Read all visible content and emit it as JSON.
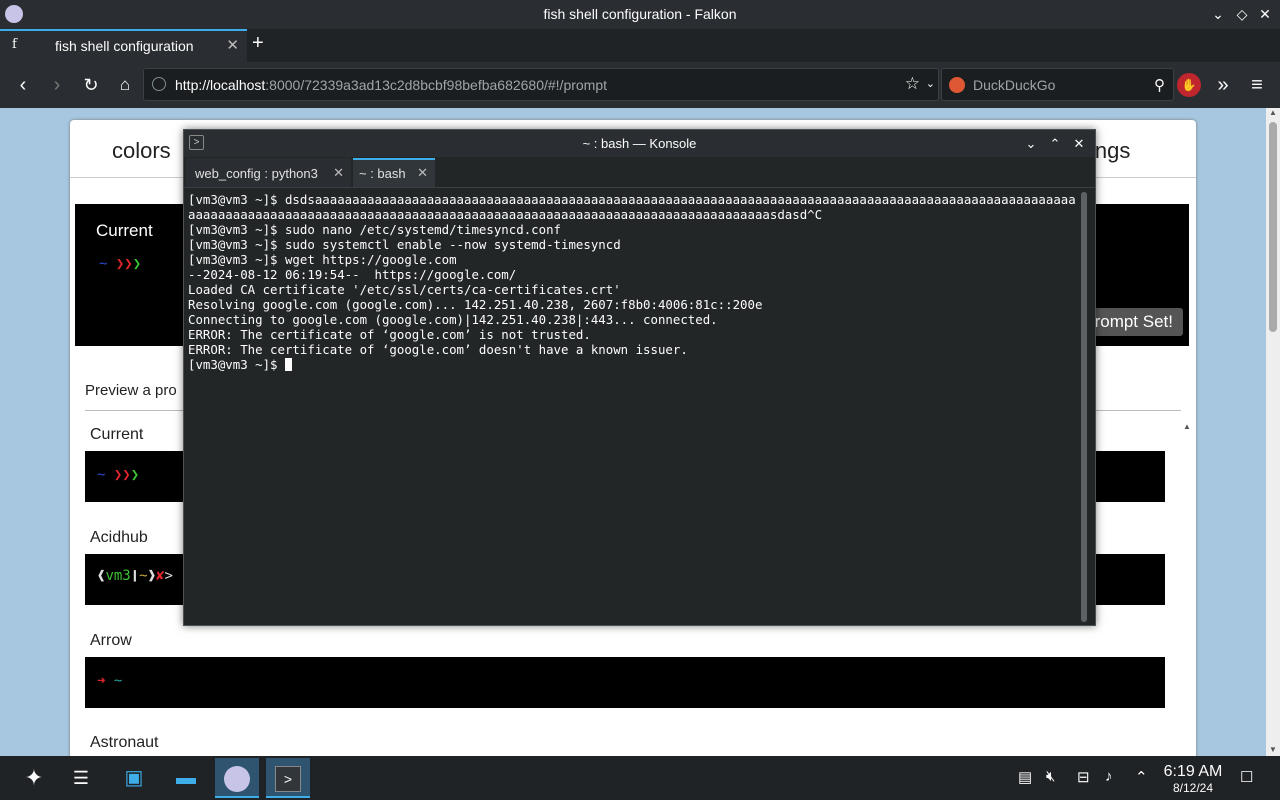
{
  "window": {
    "title": "fish shell configuration - Falkon"
  },
  "browser": {
    "tab_label": "fish shell configuration",
    "tab_favicon": "f",
    "url_host": "http://localhost",
    "url_rest": ":8000/72339a3ad13c2d8bcbf98befba682680/#!/prompt",
    "search_engine": "DuckDuckGo"
  },
  "page": {
    "nav_left": "colors",
    "nav_right": "ings",
    "current_label": "Current",
    "current_prompt": "~ ❯❯❯",
    "set_button": "rompt Set!",
    "preview_label": "Preview a pro",
    "prompts": [
      {
        "name": "Current",
        "sample": "~ ❯❯❯"
      },
      {
        "name": "Acidhub",
        "sample": "❰vm3❙~❱✘>"
      },
      {
        "name": "Arrow",
        "sample": "➜  ~"
      },
      {
        "name": "Astronaut",
        "sample": ""
      }
    ]
  },
  "konsole": {
    "title": "~ : bash — Konsole",
    "tabs": [
      {
        "label": "web_config : python3"
      },
      {
        "label": "~ : bash"
      }
    ],
    "lines": [
      "[vm3@vm3 ~]$ dsdsaaaaaaaaaaaaaaaaaaaaaaaaaaaaaaaaaaaaaaaaaaaaaaaaaaaaaaaaaaaaaaaaaaaaaaaaaaaaaaaaaaaaaaaaaaaaaaaaaaaaaaaaaaaaaaaaaaaaaaaaaaaaaaaaaaaaaaaaaaaaaaaaaaaaaaaaaaaaaaaaaaaaaaaaaaaaaaaaaaaasdasd^C",
      "[vm3@vm3 ~]$ sudo nano /etc/systemd/timesyncd.conf",
      "[vm3@vm3 ~]$ sudo systemctl enable --now systemd-timesyncd",
      "[vm3@vm3 ~]$ wget https://google.com",
      "--2024-08-12 06:19:54--  https://google.com/",
      "Loaded CA certificate '/etc/ssl/certs/ca-certificates.crt'",
      "Resolving google.com (google.com)... 142.251.40.238, 2607:f8b0:4006:81c::200e",
      "Connecting to google.com (google.com)|142.251.40.238|:443... connected.",
      "ERROR: The certificate of ‘google.com’ is not trusted.",
      "ERROR: The certificate of ‘google.com’ doesn't have a known issuer.",
      "[vm3@vm3 ~]$ "
    ]
  },
  "taskbar": {
    "time": "6:19 AM",
    "date": "8/12/24"
  },
  "colors": {
    "accent": "#3daee9",
    "page_bg": "#a7c7e0",
    "terminal_bg": "#232627"
  }
}
